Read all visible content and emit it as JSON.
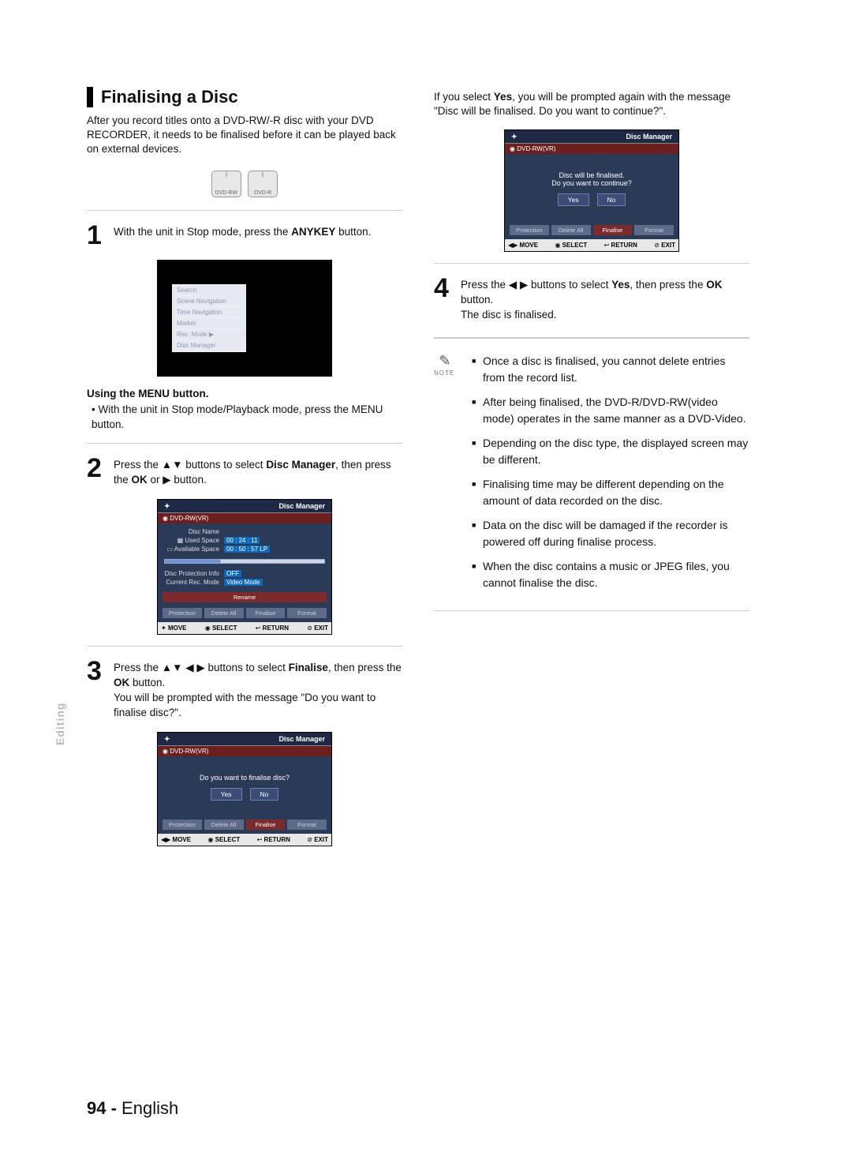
{
  "section_title": "Finalising a Disc",
  "intro": "After you record titles onto a DVD-RW/-R disc with your DVD RECORDER, it needs to be finalised before it can be played back on external devices.",
  "disc_icons": [
    "DVD-RW",
    "DVD-R"
  ],
  "steps": {
    "s1": {
      "num": "1",
      "text_pre": "With the unit in Stop mode, press the ",
      "key": "ANYKEY",
      "text_post": " button."
    },
    "s2": {
      "num": "2",
      "text": "Press the ▲▼ buttons to select Disc Manager, then press the OK or ▶ button."
    },
    "s3": {
      "num": "3",
      "text": "Press the ▲▼ ◀ ▶ buttons to select Finalise, then press the OK button.\nYou will be prompted with the message \"Do you want to finalise disc?\"."
    },
    "s4": {
      "num": "4",
      "text": "Press the ◀ ▶ buttons to select Yes, then press the OK button.\nThe disc is finalised."
    }
  },
  "right_top": "If you select Yes, you will be prompted again with the message \"Disc will be finalised. Do you want to continue?\".",
  "menu_sub": {
    "heading": "Using the MENU button.",
    "bullet": "With the unit in Stop mode/Playback mode, press the MENU button."
  },
  "anykey_menu": [
    "Search",
    "Scene Navigation",
    "Time Navigation",
    "Marker",
    "Rec. Mode                ▶",
    "Disc Manager"
  ],
  "dm_screen": {
    "title": "Disc Manager",
    "disc_type": "DVD-RW(VR)",
    "rows": {
      "disc_name_k": "Disc Name",
      "used_k": "Used Space",
      "used_v": "00 : 24 : 11",
      "avail_k": "Available Space",
      "avail_v": "00 : 50 : 57 LP",
      "prot_k": "Disc Protection Info",
      "prot_v": "OFF",
      "mode_k": "Current Rec. Mode",
      "mode_v": "Video Mode"
    },
    "btns": [
      "Rename",
      "Protection",
      "Delete All",
      "Finalise",
      "Format"
    ],
    "footer": {
      "move": "MOVE",
      "select": "SELECT",
      "return": "RETURN",
      "exit": "EXIT"
    }
  },
  "dlg1": {
    "msg": "Do you want to finalise disc?",
    "yes": "Yes",
    "no": "No"
  },
  "dlg2": {
    "msg1": "Disc will be finalised.",
    "msg2": "Do you want to continue?",
    "yes": "Yes",
    "no": "No"
  },
  "notes": {
    "label": "NOTE",
    "items": [
      "Once a disc is finalised, you cannot delete entries from the record list.",
      "After being finalised, the DVD-R/DVD-RW(video mode) operates in the same manner as a DVD-Video.",
      "Depending on the disc type, the displayed screen may be different.",
      "Finalising time may be different depending on the amount of data recorded on the disc.",
      "Data on the disc will be damaged if the recorder is powered off during finalise process.",
      "When the disc contains a music or JPEG files, you cannot finalise the disc."
    ]
  },
  "side_tab": "Editing",
  "footer": {
    "page": "94 -",
    "lang": "English"
  }
}
